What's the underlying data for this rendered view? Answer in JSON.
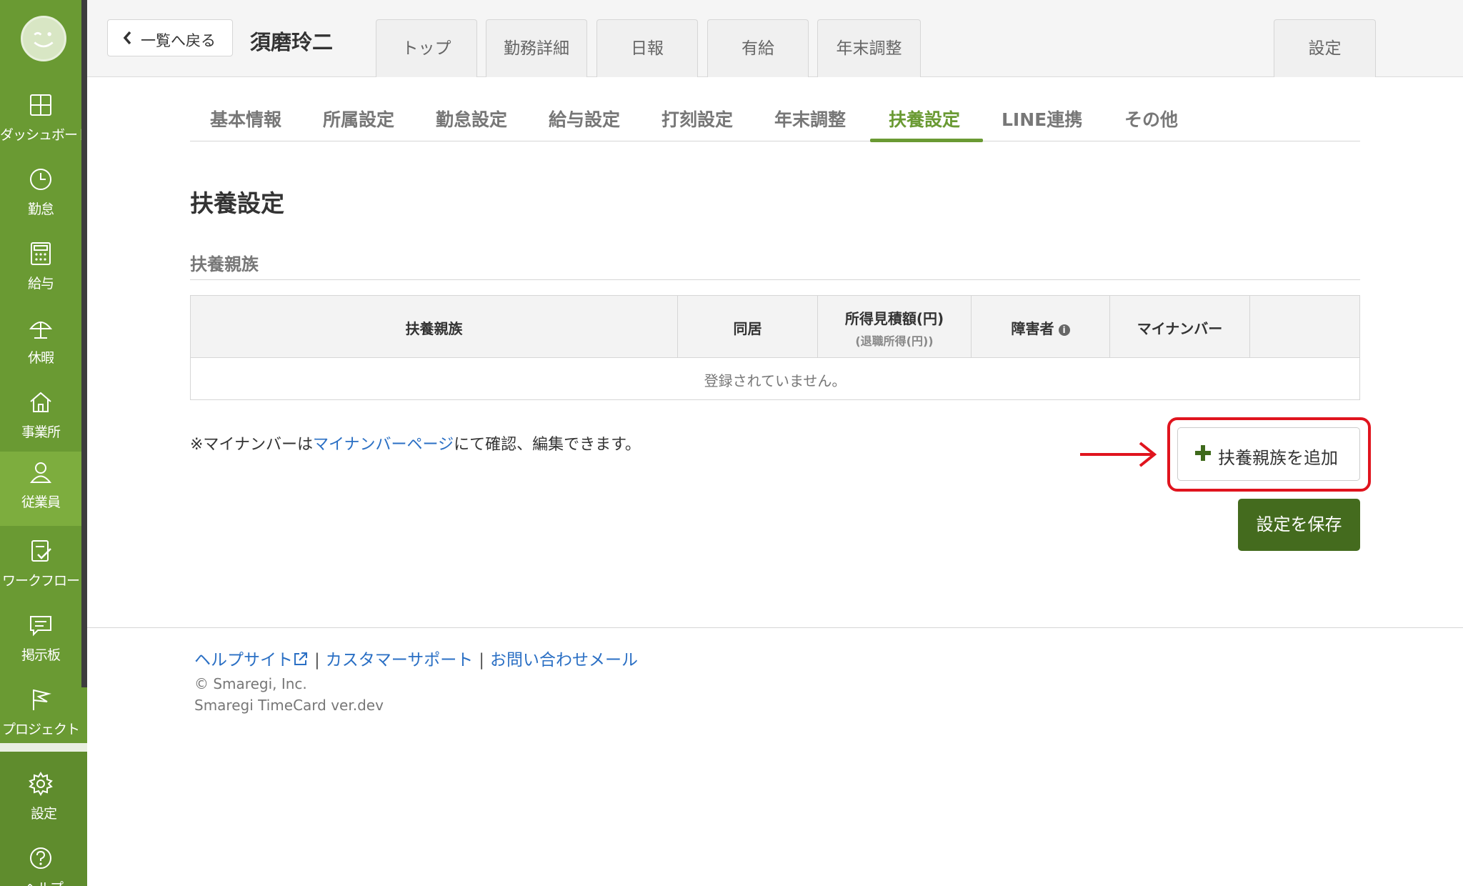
{
  "sidebar": {
    "items": [
      {
        "label": "ダッシュボード",
        "icon": "dashboard-icon"
      },
      {
        "label": "勤怠",
        "icon": "clock-icon"
      },
      {
        "label": "給与",
        "icon": "calculator-icon"
      },
      {
        "label": "休暇",
        "icon": "umbrella-icon"
      },
      {
        "label": "事業所",
        "icon": "home-icon"
      },
      {
        "label": "従業員",
        "icon": "person-icon"
      },
      {
        "label": "ワークフロー",
        "icon": "checklist-icon"
      },
      {
        "label": "掲示板",
        "icon": "chat-icon"
      },
      {
        "label": "プロジェクト",
        "icon": "flag-icon"
      },
      {
        "label": "設定",
        "icon": "gear-icon"
      },
      {
        "label": "ヘルプ",
        "icon": "help-icon"
      }
    ],
    "active_index": 5,
    "accent_color": "#6a9a33"
  },
  "header": {
    "back_label": "一覧へ戻る",
    "employee_name": "須磨玲二",
    "tabs": [
      "トップ",
      "勤務詳細",
      "日報",
      "有給",
      "年末調整"
    ],
    "settings_tab": "設定"
  },
  "subtabs": {
    "items": [
      "基本情報",
      "所属設定",
      "勤怠設定",
      "給与設定",
      "打刻設定",
      "年末調整",
      "扶養設定",
      "LINE連携",
      "その他"
    ],
    "active_index": 6
  },
  "page_title": "扶養設定",
  "section_title": "扶養親族",
  "table": {
    "columns": [
      {
        "label": "扶養親族"
      },
      {
        "label": "同居"
      },
      {
        "label": "所得見積額(円)",
        "sub": "(退職所得(円))"
      },
      {
        "label": "障害者",
        "info_icon": "info-icon"
      },
      {
        "label": "マイナンバー"
      },
      {
        "label": ""
      }
    ],
    "empty_message": "登録されていません。"
  },
  "note": {
    "prefix": "※マイナンバーは",
    "link": "マイナンバーページ",
    "suffix": "にて確認、編集できます。"
  },
  "buttons": {
    "add_dependent": "扶養親族を追加",
    "save": "設定を保存"
  },
  "footer": {
    "help_site": "ヘルプサイト",
    "support": "カスタマーサポート",
    "contact": "お問い合わせメール",
    "separator": "|",
    "copyright": "© Smaregi, Inc.",
    "version": "Smaregi TimeCard ver.dev"
  }
}
